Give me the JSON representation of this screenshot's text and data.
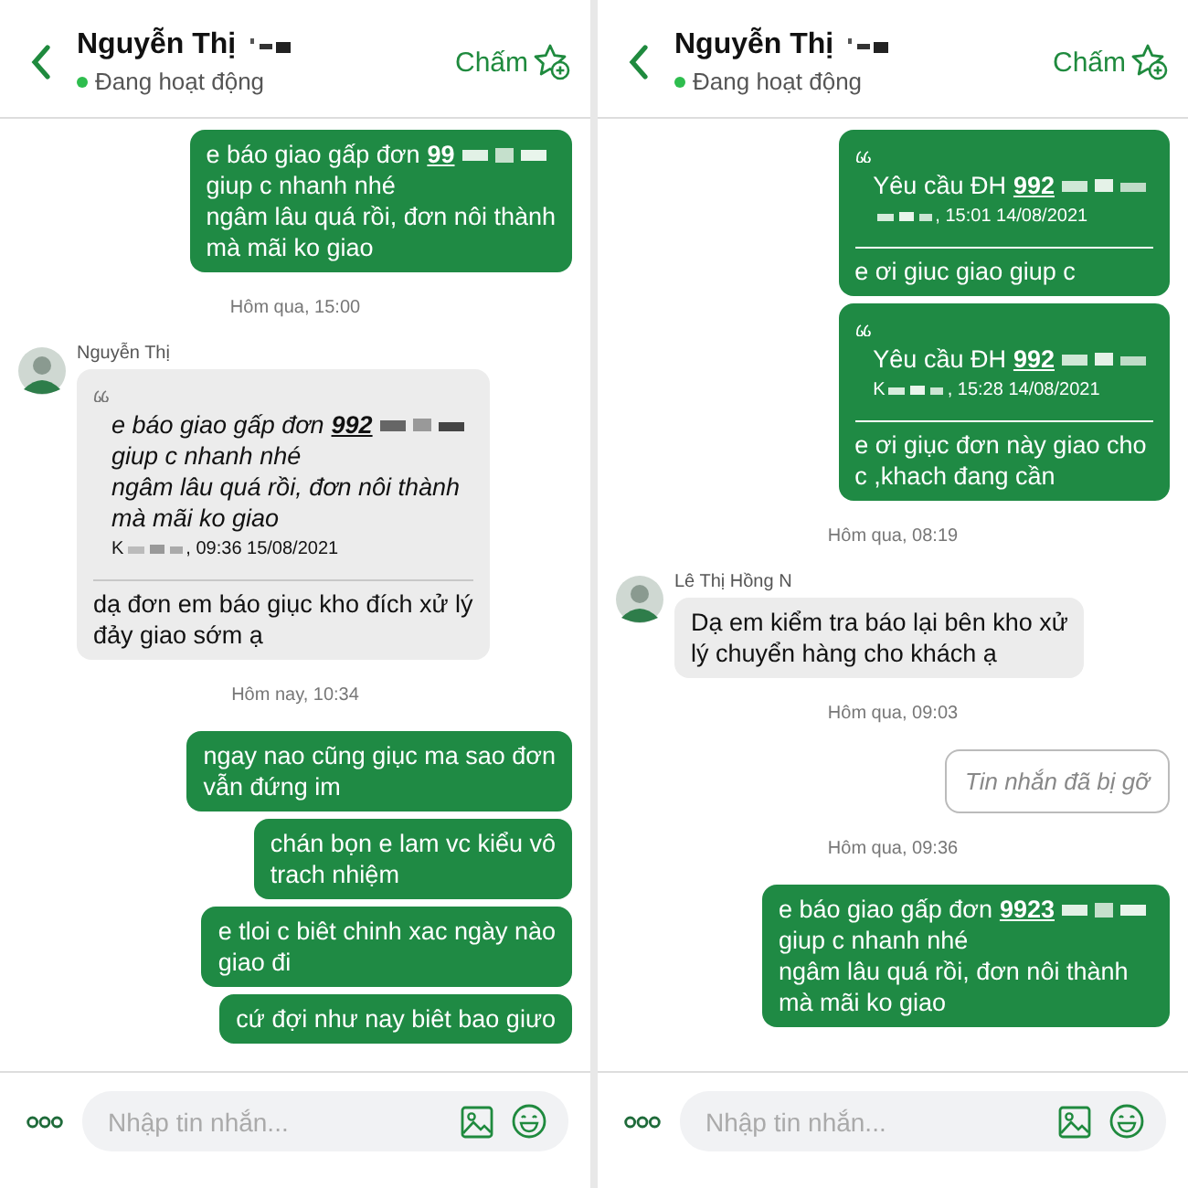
{
  "panels": [
    {
      "header": {
        "name": "Nguyễn Thị",
        "status": "Đang hoạt động",
        "action": "Chấm"
      },
      "messages": [
        {
          "kind": "out",
          "lead": "e báo giao gấp đơn",
          "order": "99",
          "text": "giup c nhanh nhé\nngâm lâu quá rồi, đơn nôi thành\nmà mãi ko giao"
        },
        {
          "kind": "time",
          "text": "Hôm qua, 15:00"
        },
        {
          "kind": "in",
          "sender": "Nguyễn Thị",
          "quote": {
            "lead": "e báo giao gấp đơn",
            "order": "992",
            "text": "giup c nhanh nhé\nngâm lâu quá rồi, đơn nôi thành\nmà mãi ko giao",
            "meta_prefix": "K",
            "meta": ", 09:36 15/08/2021"
          },
          "text": "dạ đơn em báo giục kho đích xử lý\nđảy giao sớm ạ"
        },
        {
          "kind": "time",
          "text": "Hôm nay, 10:34"
        },
        {
          "kind": "out",
          "text": "ngay nao cũng giục ma sao đơn\nvẫn đứng im"
        },
        {
          "kind": "out",
          "text": "chán bọn e lam vc kiểu vô\ntrach nhiệm"
        },
        {
          "kind": "out",
          "text": "e tloi c biêt chinh xac ngày nào\ngiao đi"
        },
        {
          "kind": "out",
          "text": "cứ đợi như nay biêt bao giưo"
        }
      ],
      "composer": {
        "placeholder": "Nhập tin nhắn..."
      }
    },
    {
      "header": {
        "name": "Nguyễn Thị",
        "status": "Đang hoạt động",
        "action": "Chấm"
      },
      "messages": [
        {
          "kind": "out",
          "quote": {
            "lead": "Yêu cầu ĐH",
            "order": "992",
            "meta": ", 15:01 14/08/2021"
          },
          "text": "e ơi giuc giao giup c"
        },
        {
          "kind": "out",
          "quote": {
            "lead": "Yêu cầu ĐH",
            "order": "992",
            "meta_prefix": "K",
            "meta": ", 15:28 14/08/2021"
          },
          "text": "e ơi giục đơn này giao cho\nc ,khach đang cần"
        },
        {
          "kind": "time",
          "text": "Hôm qua, 08:19"
        },
        {
          "kind": "in",
          "sender": "Lê Thị Hồng N",
          "text": "Dạ em kiểm tra báo lại bên kho xử\nlý chuyển hàng cho khách ạ"
        },
        {
          "kind": "time",
          "text": "Hôm qua, 09:03"
        },
        {
          "kind": "recalled",
          "text": "Tin nhắn đã bị gỡ"
        },
        {
          "kind": "time",
          "text": "Hôm qua, 09:36"
        },
        {
          "kind": "out",
          "lead": "e báo giao gấp đơn",
          "order": "9923",
          "text": "giup c nhanh nhé\nngâm lâu quá rồi, đơn nôi thành\nmà mãi ko giao"
        }
      ],
      "composer": {
        "placeholder": "Nhập tin nhắn..."
      }
    }
  ]
}
